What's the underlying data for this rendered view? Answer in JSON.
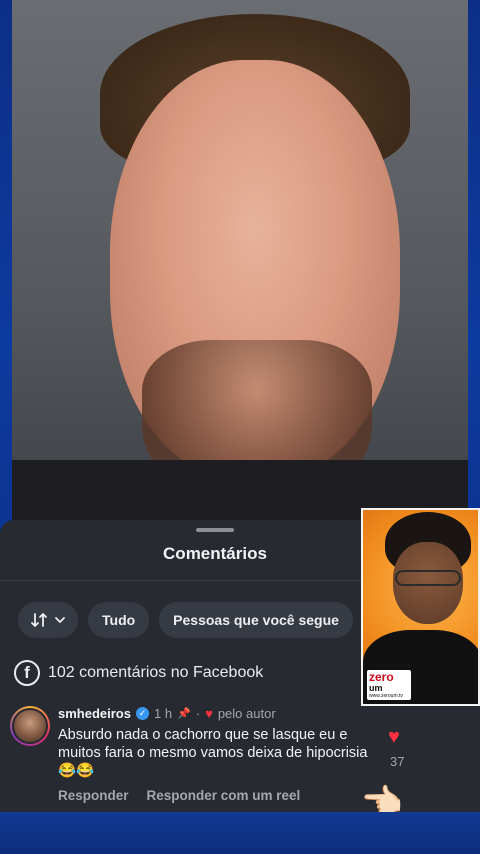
{
  "sheet": {
    "title": "Comentários",
    "chips": [
      "Tudo",
      "Pessoas que você segue"
    ],
    "facebook_count": "102 comentários no Facebook"
  },
  "comment": {
    "username": "smhedeiros",
    "time": "1 h",
    "author_tag": "pelo autor",
    "text": "Absurdo nada o cachorro que se lasque  eu e muitos faria o mesmo vamos deixa de hipocrisia 😂😂",
    "like_count": "37",
    "reply": "Responder",
    "reply_reel": "Responder com um reel"
  },
  "inset": {
    "logo_brand": "zero",
    "logo_sub": "um",
    "logo_url": "www.zeroum.tv"
  },
  "icons": {
    "sort": "sort-arrows-icon",
    "chevron": "chevron-down-icon",
    "facebook": "facebook-icon",
    "verified": "verified-badge-icon",
    "pin": "pin-icon",
    "heart": "heart-icon",
    "hand": "pointing-hand-icon"
  },
  "colors": {
    "accent_heart": "#ff3040",
    "verified": "#3897f0",
    "sheet_bg": "#272a31"
  }
}
